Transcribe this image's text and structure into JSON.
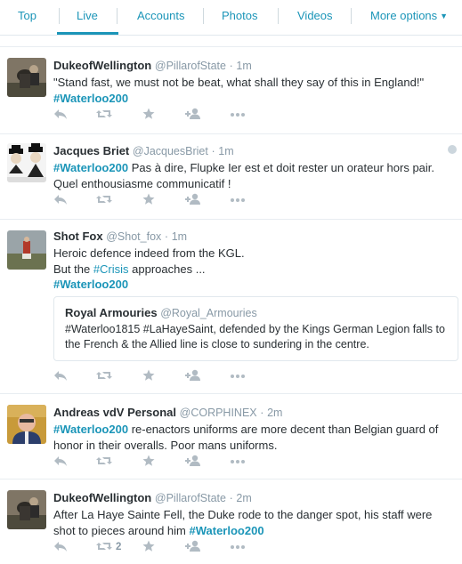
{
  "tabs": [
    {
      "label": "Top"
    },
    {
      "label": "Live"
    },
    {
      "label": "Accounts"
    },
    {
      "label": "Photos"
    },
    {
      "label": "Videos"
    },
    {
      "label": "More options"
    }
  ],
  "colors": {
    "accent": "#1b95b8",
    "muted": "#8899a6",
    "text": "#292f33",
    "border": "#e1e8ed"
  },
  "tweets": [
    {
      "fullname": "DukeofWellington",
      "username": "@PillarofState",
      "time": "1m",
      "text": "\"Stand fast, we must not be beat, what shall they say of this in England!\"",
      "hashtag": "#Waterloo200"
    },
    {
      "fullname": "Jacques Briet",
      "username": "@JacquesBriet",
      "time": "1m",
      "hashtag": "#Waterloo200",
      "text": "Pas à dire, Flupke Ier est et doit rester un orateur hors pair. Quel enthousiasme communicatif !"
    },
    {
      "fullname": "Shot Fox",
      "username": "@Shot_fox",
      "time": "1m",
      "line1": "Heroic defence indeed from the KGL.",
      "line2_pre": "But the ",
      "line2_tag": "#Crisis",
      "line2_post": " approaches ...",
      "hashtag": "#Waterloo200",
      "quote": {
        "fullname": "Royal Armouries",
        "username": "@Royal_Armouries",
        "text": "#Waterloo1815 #LaHayeSaint, defended by the Kings German Legion falls to the French & the Allied line is close to sundering in the centre."
      }
    },
    {
      "fullname": "Andreas vdV Personal",
      "username": "@CORPHINEX",
      "time": "2m",
      "hashtag": "#Waterloo200",
      "text": "re-enactors uniforms are more decent than Belgian guard of honor in their overalls. Poor mans uniforms."
    },
    {
      "fullname": "DukeofWellington",
      "username": "@PillarofState",
      "time": "2m",
      "text": "After La Haye Sainte Fell, the Duke rode to the danger spot, his staff were shot to pieces around him",
      "hashtag": "#Waterloo200",
      "retweet_count": "2"
    }
  ],
  "icons": {
    "reply": "reply-icon",
    "retweet": "retweet-icon",
    "favorite": "star-icon",
    "follow": "follow-icon",
    "more": "more-icon",
    "chevron": "chevron-down-icon",
    "gear": "gear-icon"
  },
  "separator": "·"
}
